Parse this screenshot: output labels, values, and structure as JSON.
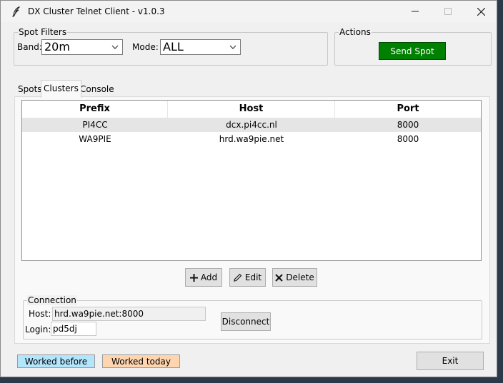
{
  "window": {
    "title": "DX Cluster Telnet Client - v1.0.3"
  },
  "spot_filters": {
    "label": "Spot Filters",
    "band_label": "Band:",
    "band_value": "20m",
    "mode_label": "Mode:",
    "mode_value": "ALL"
  },
  "actions": {
    "label": "Actions",
    "send_spot": "Send Spot"
  },
  "tabs": [
    {
      "label": "Spots"
    },
    {
      "label": "Clusters"
    },
    {
      "label": "Console"
    }
  ],
  "clusters_table": {
    "columns": [
      "Prefix",
      "Host",
      "Port"
    ],
    "rows": [
      {
        "prefix": "PI4CC",
        "host": "dcx.pi4cc.nl",
        "port": "8000"
      },
      {
        "prefix": "WA9PIE",
        "host": "hrd.wa9pie.net",
        "port": "8000"
      }
    ]
  },
  "cluster_buttons": {
    "add": "Add",
    "edit": "Edit",
    "delete": "Delete"
  },
  "connection": {
    "label": "Connection",
    "host_label": "Host:",
    "host_value": "hrd.wa9pie.net:8000",
    "login_label": "Login:",
    "login_value": "pd5dj",
    "disconnect": "Disconnect"
  },
  "legend": {
    "worked_before": "Worked before",
    "worked_before_color": "#b3e5fc",
    "worked_today": "Worked today",
    "worked_today_color": "#ffd5b0"
  },
  "exit": "Exit",
  "colors": {
    "send_spot_bg": "#008000"
  }
}
